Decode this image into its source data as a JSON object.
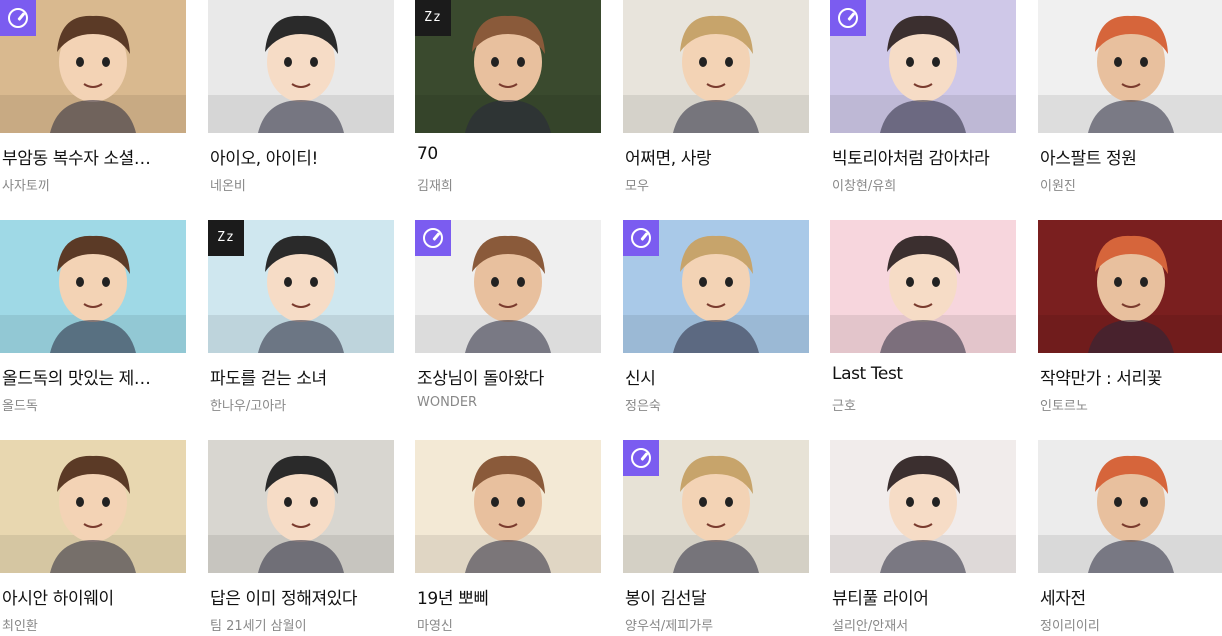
{
  "items": [
    {
      "title": "부암동 복수자 소셜…",
      "author": "사자토끼",
      "badge": "clock-icon",
      "bg": "#d9b98f"
    },
    {
      "title": "아이오, 아이티!",
      "author": "네온비",
      "badge": "",
      "bg": "#e9e9e9"
    },
    {
      "title": "70",
      "author": "김재희",
      "badge": "zz-icon",
      "bg": "#3a4a2e"
    },
    {
      "title": "어쩌면, 사랑",
      "author": "모우",
      "badge": "",
      "bg": "#e8e4dc"
    },
    {
      "title": "빅토리아처럼 감아차라",
      "author": "이창현/유희",
      "badge": "clock-icon",
      "bg": "#cfc8e8"
    },
    {
      "title": "아스팔트 정원",
      "author": "이원진",
      "badge": "",
      "bg": "#f0f0f0"
    },
    {
      "title": "올드독의 맛있는 제…",
      "author": "올드독",
      "badge": "",
      "bg": "#9fd9e6"
    },
    {
      "title": "파도를 걷는 소녀",
      "author": "한나우/고아라",
      "badge": "zz-icon",
      "bg": "#cfe7ef"
    },
    {
      "title": "조상님이 돌아왔다",
      "author": "WONDER",
      "badge": "clock-icon",
      "bg": "#efefef"
    },
    {
      "title": "신시",
      "author": "정은숙",
      "badge": "clock-icon",
      "bg": "#a9c9e8"
    },
    {
      "title": "Last Test",
      "author": "근호",
      "badge": "",
      "bg": "#f7d6dd"
    },
    {
      "title": "작약만가 : 서리꽃",
      "author": "인토르노",
      "badge": "",
      "bg": "#7a1f1f"
    },
    {
      "title": "아시안 하이웨이",
      "author": "최인환",
      "badge": "",
      "bg": "#e8d7b0"
    },
    {
      "title": "답은 이미 정해져있다",
      "author": "팀 21세기 삼월이",
      "badge": "",
      "bg": "#d8d6d0"
    },
    {
      "title": "19년 뽀삐",
      "author": "마영신",
      "badge": "",
      "bg": "#f3e9d5"
    },
    {
      "title": "봉이 김선달",
      "author": "양우석/제피가루",
      "badge": "clock-icon",
      "bg": "#e7e2d6"
    },
    {
      "title": "뷰티풀 라이어",
      "author": "설리안/안재서",
      "badge": "",
      "bg": "#f1eceb"
    },
    {
      "title": "세자전",
      "author": "정이리이리",
      "badge": "",
      "bg": "#ececec"
    }
  ]
}
